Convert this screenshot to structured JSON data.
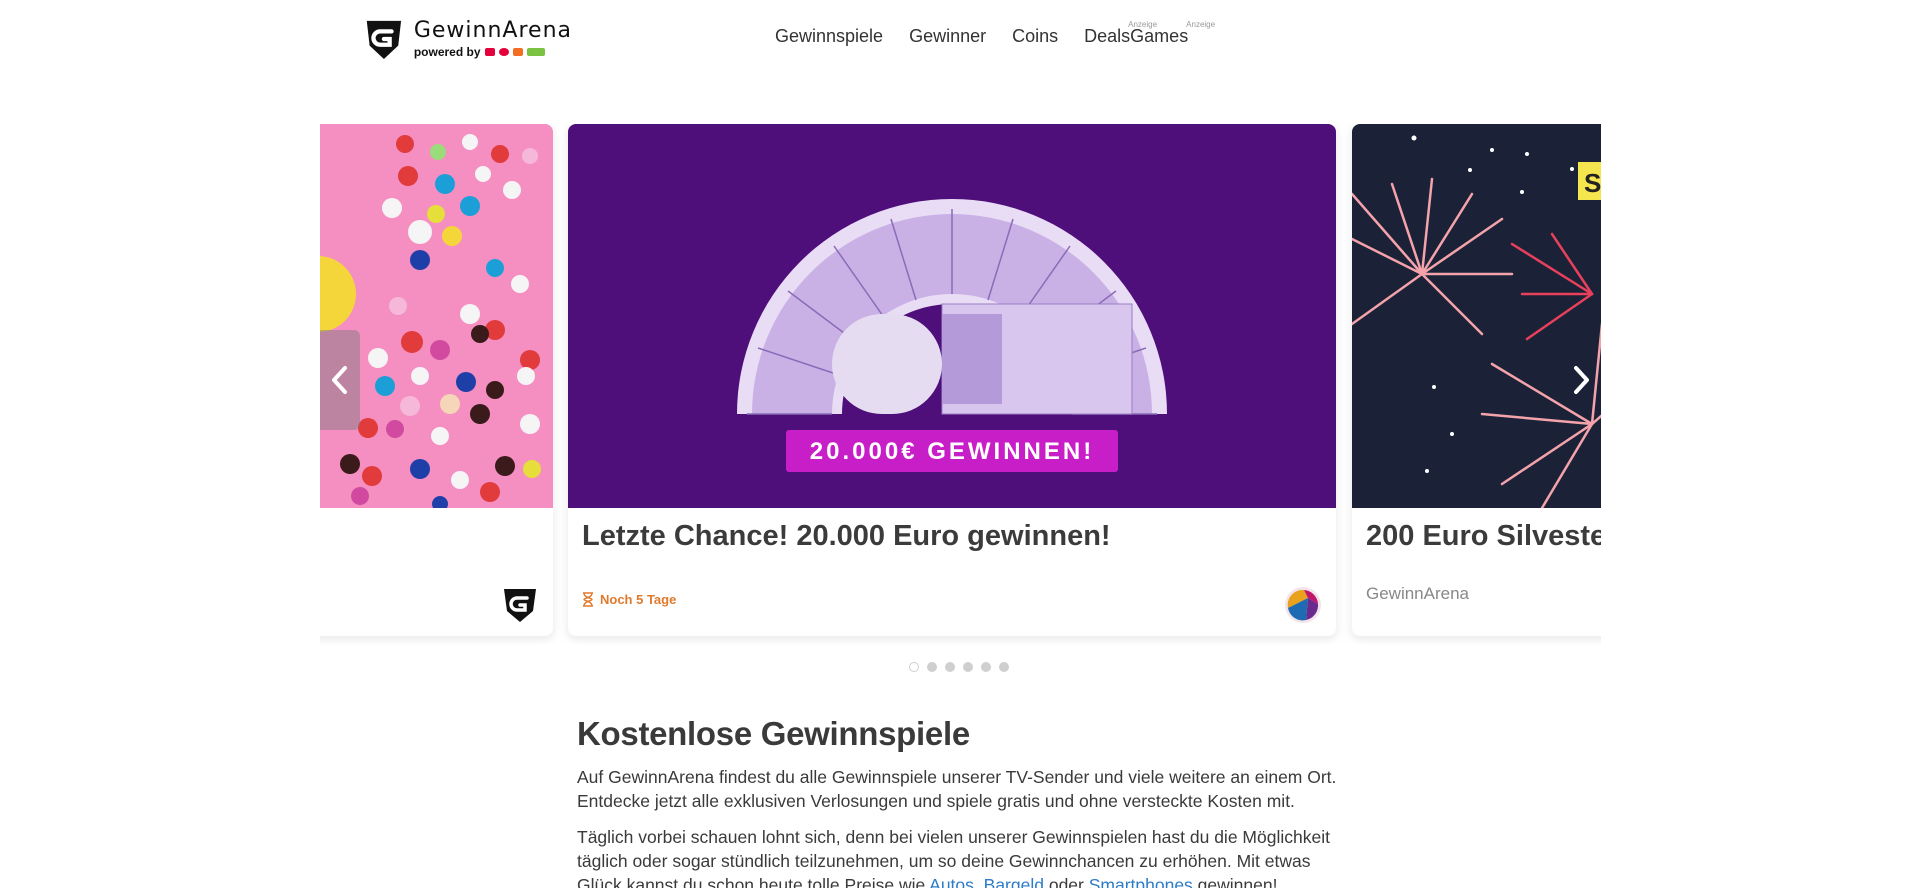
{
  "header": {
    "logo": {
      "name": "GewinnArena",
      "powered_by": "powered by"
    },
    "nav": [
      {
        "label": "Gewinnspiele"
      },
      {
        "label": "Gewinner"
      },
      {
        "label": "Coins"
      },
      {
        "label": "Deals",
        "sup": "Anzeige"
      },
      {
        "label": "Games",
        "sup": "Anzeige"
      }
    ]
  },
  "carousel": {
    "center": {
      "title": "Letzte Chance! 20.000 Euro gewinnen!",
      "banner": "20.000€ GEWINNEN!",
      "deadline": "Noch 5 Tage"
    },
    "right": {
      "title": "200 Euro Silveste",
      "source": "GewinnArena",
      "badge": "S"
    },
    "dots_total": 6,
    "active_dot": 0
  },
  "main": {
    "heading": "Kostenlose Gewinnspiele",
    "para1": "Auf GewinnArena findest du alle Gewinnspiele unserer TV-Sender und viele weitere an einem Ort. Entdecke jetzt alle exklusiven Verlosungen und spiele gratis und ohne versteckte Kosten mit.",
    "para2_start": "Täglich vorbei schauen lohnt sich, denn bei vielen unserer Gewinnspielen hast du die Möglichkeit täglich oder sogar stündlich teilzunehmen, um so deine Gewinnchancen zu erhöhen. Mit etwas Glück kannst du schon heute tolle Preise wie ",
    "link_autos": "Autos",
    "sep1": ", ",
    "link_bargeld": "Bargeld",
    "sep2": " oder ",
    "link_smartphones": "Smartphones",
    "para2_end": " gewinnen!"
  },
  "colors": {
    "accent_orange": "#e07a2c",
    "link_blue": "#2c7cc8",
    "purple_bg": "#4f0f7a",
    "banner_magenta": "#c81ec8"
  }
}
